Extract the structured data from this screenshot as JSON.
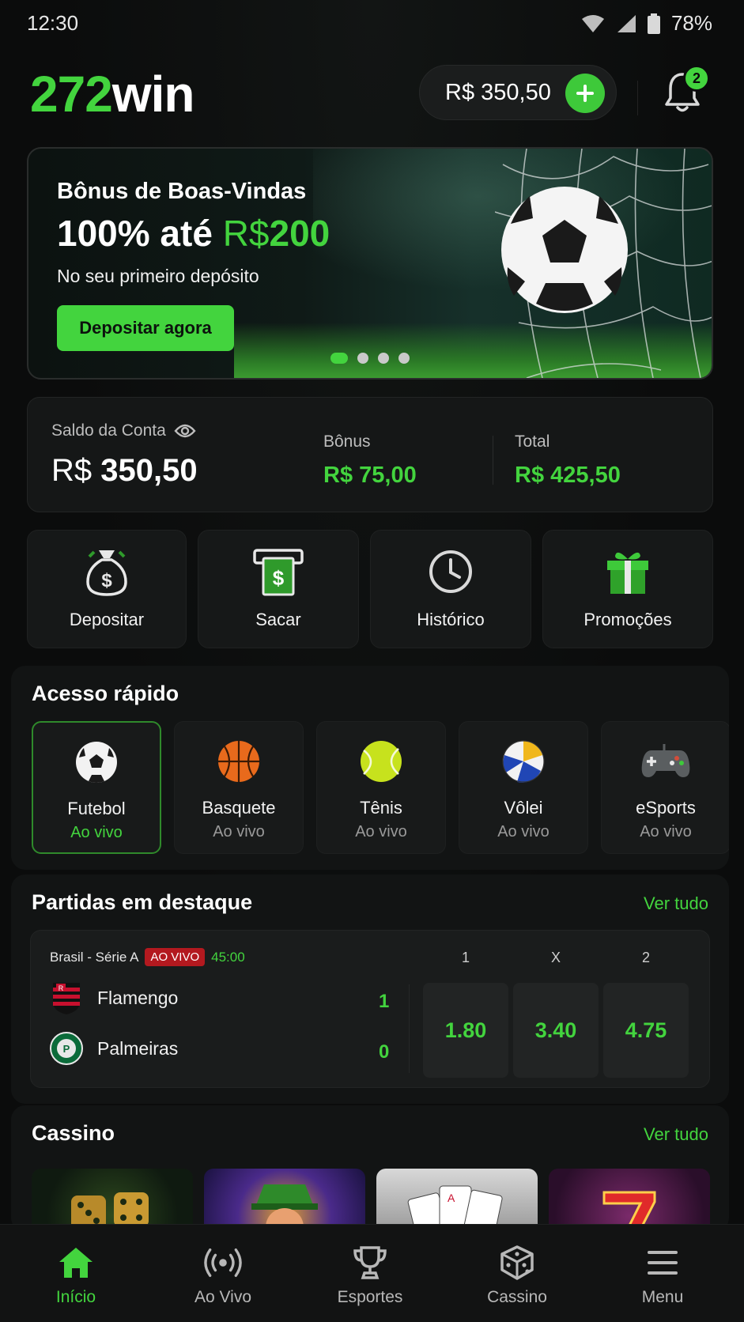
{
  "status": {
    "time": "12:30",
    "battery": "78%"
  },
  "header": {
    "logo_num": "272",
    "logo_text": "win",
    "balance": "R$ 350,50",
    "notifications": "2"
  },
  "banner": {
    "subtitle": "Bônus de Boas-Vindas",
    "headline_prefix": "100% até ",
    "headline_currency": "R$",
    "headline_value": "200",
    "note": "No seu primeiro depósito",
    "cta": "Depositar agora",
    "slides": 4,
    "active_slide": 1
  },
  "account": {
    "label": "Saldo da Conta",
    "currency": "R$",
    "amount": "350,50",
    "bonus_label": "Bônus",
    "bonus_value": "R$ 75,00",
    "total_label": "Total",
    "total_value": "R$ 425,50"
  },
  "actions": [
    {
      "label": "Depositar",
      "icon": "money-bag-icon"
    },
    {
      "label": "Sacar",
      "icon": "cash-withdraw-icon"
    },
    {
      "label": "Histórico",
      "icon": "clock-icon"
    },
    {
      "label": "Promoções",
      "icon": "gift-icon"
    }
  ],
  "quick_access": {
    "title": "Acesso rápido",
    "items": [
      {
        "name": "Futebol",
        "status": "Ao vivo",
        "icon": "soccer-ball-icon",
        "active": true
      },
      {
        "name": "Basquete",
        "status": "Ao vivo",
        "icon": "basketball-icon"
      },
      {
        "name": "Tênis",
        "status": "Ao vivo",
        "icon": "tennis-ball-icon"
      },
      {
        "name": "Vôlei",
        "status": "Ao vivo",
        "icon": "volleyball-icon"
      },
      {
        "name": "eSports",
        "status": "Ao vivo",
        "icon": "gamepad-icon"
      }
    ]
  },
  "featured": {
    "title": "Partidas em destaque",
    "see_all": "Ver tudo",
    "match": {
      "league": "Brasil - Série A",
      "live": "AO VIVO",
      "time": "45:00",
      "home": "Flamengo",
      "away": "Palmeiras",
      "home_score": "1",
      "away_score": "0",
      "odd_labels": [
        "1",
        "X",
        "2"
      ],
      "odds": [
        "1.80",
        "3.40",
        "4.75"
      ]
    }
  },
  "casino": {
    "title": "Cassino",
    "see_all": "Ver tudo"
  },
  "nav": [
    {
      "label": "Início",
      "icon": "home-icon",
      "active": true
    },
    {
      "label": "Ao Vivo",
      "icon": "live-broadcast-icon"
    },
    {
      "label": "Esportes",
      "icon": "trophy-icon"
    },
    {
      "label": "Cassino",
      "icon": "dice-icon"
    },
    {
      "label": "Menu",
      "icon": "hamburger-menu-icon"
    }
  ],
  "colors": {
    "accent": "#43d43e",
    "background": "#0b0c0c",
    "live_red": "#b3191f"
  }
}
